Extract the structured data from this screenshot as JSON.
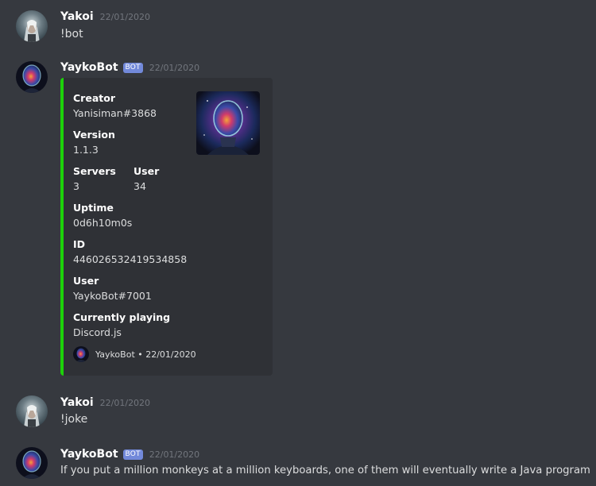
{
  "messages": {
    "m1": {
      "username": "Yakoi",
      "timestamp": "22/01/2020",
      "text": "!bot"
    },
    "m2": {
      "username": "YaykoBot",
      "bot_tag": "BOT",
      "timestamp": "22/01/2020",
      "embed": {
        "accent_color": "#1dd10a",
        "fields": {
          "creator": {
            "name": "Creator",
            "value": "Yanisiman#3868"
          },
          "version": {
            "name": "Version",
            "value": "1.1.3"
          },
          "servers": {
            "name": "Servers",
            "value": "3"
          },
          "user_count": {
            "name": "User",
            "value": "34"
          },
          "uptime": {
            "name": "Uptime",
            "value": "0d6h10m0s"
          },
          "id": {
            "name": "ID",
            "value": "446026532419534858"
          },
          "user": {
            "name": "User",
            "value": "YaykoBot#7001"
          },
          "playing": {
            "name": "Currently playing",
            "value": "Discord.js"
          }
        },
        "footer": "YaykoBot • 22/01/2020"
      }
    },
    "m3": {
      "username": "Yakoi",
      "timestamp": "22/01/2020",
      "text": "!joke"
    },
    "m4": {
      "username": "YaykoBot",
      "bot_tag": "BOT",
      "timestamp": "22/01/2020",
      "text": "If you put a million monkeys at a million keyboards, one of them will eventually write a Java program"
    }
  },
  "colors": {
    "background": "#36393f",
    "embed_background": "#2f3136",
    "bot_tag": "#7289da",
    "embed_accent": "#1dd10a"
  },
  "icons": {
    "user_avatar": "witcher-avatar",
    "bot_avatar": "astronaut-nebula-avatar"
  }
}
